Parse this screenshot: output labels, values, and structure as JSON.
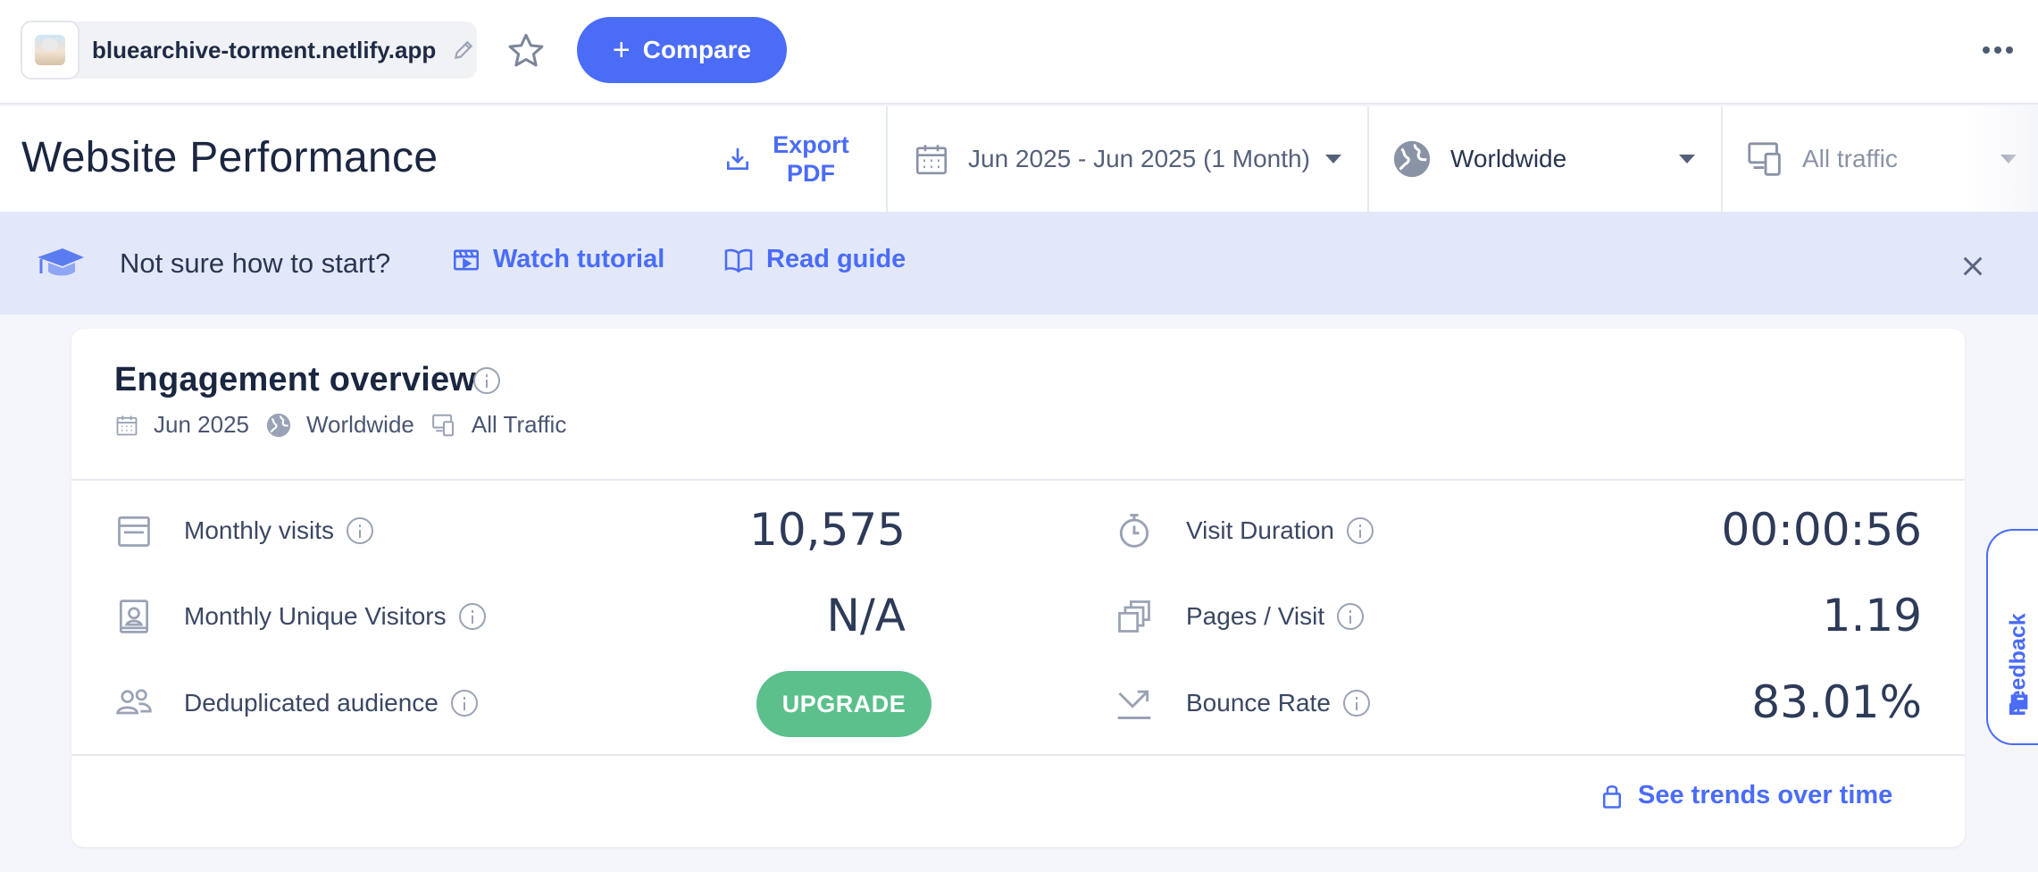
{
  "topbar": {
    "site_name": "bluearchive-torment.netlify.app",
    "compare_label": "Compare"
  },
  "header": {
    "title": "Website Performance",
    "export_label": "Export PDF",
    "date_range": "Jun 2025 - Jun 2025 (1 Month)",
    "region": "Worldwide",
    "traffic": "All traffic"
  },
  "banner": {
    "text": "Not sure how to start?",
    "watch_tutorial": "Watch tutorial",
    "read_guide": "Read guide"
  },
  "card": {
    "title": "Engagement overview",
    "meta": {
      "date": "Jun 2025",
      "region": "Worldwide",
      "traffic": "All Traffic"
    },
    "metrics_left": [
      {
        "label": "Monthly visits",
        "value": "10,575"
      },
      {
        "label": "Monthly Unique Visitors",
        "value": "N/A"
      },
      {
        "label": "Deduplicated audience",
        "value": ""
      }
    ],
    "upgrade_label": "UPGRADE",
    "metrics_right": [
      {
        "label": "Visit Duration",
        "value": "00:00:56"
      },
      {
        "label": "Pages / Visit",
        "value": "1.19"
      },
      {
        "label": "Bounce Rate",
        "value": "83.01%"
      }
    ],
    "trends_label": "See trends over time"
  },
  "feedback": {
    "label": "Feedback"
  },
  "colors": {
    "accent": "#4a6cf7",
    "upgrade": "#5bc08c",
    "banner_bg": "#e2e8f9"
  }
}
